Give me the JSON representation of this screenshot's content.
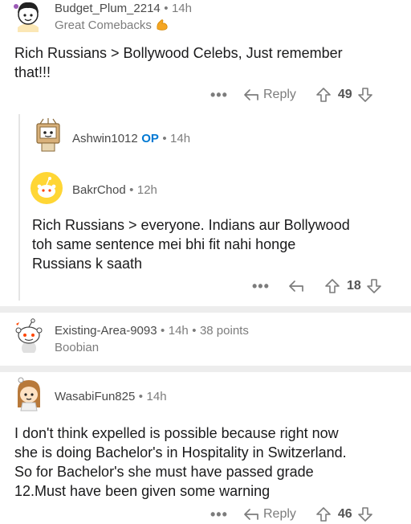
{
  "comments": [
    {
      "username": "Budget_Plum_2214",
      "time": "14h",
      "flair": "Great Comebacks",
      "flair_icon": "flexed-biceps-icon",
      "body_lines": [
        "Rich Russians > Bollywood Celebs, Just remember",
        "that!!!"
      ],
      "reply_label": "Reply",
      "score": "49"
    },
    {
      "username": "Ashwin1012",
      "op_label": "OP",
      "time": "14h"
    },
    {
      "username": "BakrChod",
      "time": "12h",
      "body_lines": [
        "Rich Russians > everyone. Indians aur Bollywood",
        "toh same sentence mei bhi fit nahi honge",
        "Russians k saath"
      ],
      "score": "18"
    },
    {
      "username": "Existing-Area-9093",
      "time": "14h",
      "points": "38 points",
      "flair": "Boobian"
    },
    {
      "username": "WasabiFun825",
      "time": "14h",
      "body_lines": [
        "I don't think expelled is possible because right now",
        "she is doing Bachelor's in Hospitality in Switzerland.",
        "So for Bachelor's she must have passed grade",
        "12.Must have been given some warning"
      ],
      "reply_label": "Reply",
      "score": "46"
    }
  ],
  "separator": "•",
  "more_label": "•••",
  "colors": {
    "accent": "#0079d3",
    "muted": "#7c7c7c",
    "divider": "#ededed",
    "flair_emoji": "#f5a623"
  }
}
